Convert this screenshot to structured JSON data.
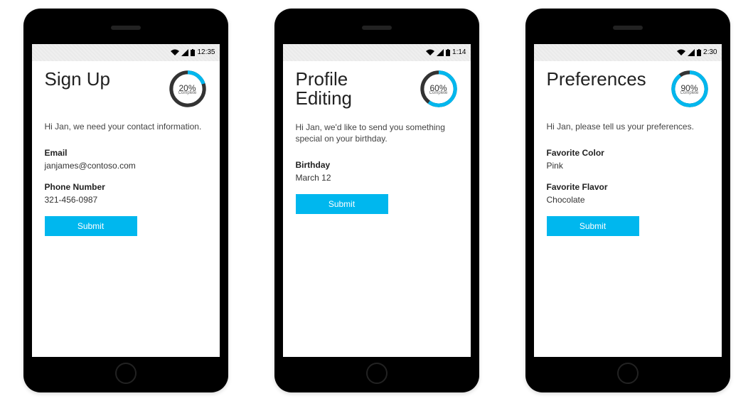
{
  "phones": [
    {
      "time": "12:35",
      "title": "Sign Up",
      "progress_pct": 20,
      "progress_label": "20%",
      "progress_sub": "Complete",
      "intro": "Hi Jan, we need your contact information.",
      "fields": [
        {
          "label": "Email",
          "value": "janjames@contoso.com"
        },
        {
          "label": "Phone Number",
          "value": "321-456-0987"
        }
      ],
      "submit": "Submit"
    },
    {
      "time": "1:14",
      "title": "Profile Editing",
      "progress_pct": 60,
      "progress_label": "60%",
      "progress_sub": "Complete",
      "intro": "Hi Jan, we'd like to send you something special on your birthday.",
      "fields": [
        {
          "label": "Birthday",
          "value": "March 12"
        }
      ],
      "submit": "Submit"
    },
    {
      "time": "2:30",
      "title": "Preferences",
      "progress_pct": 90,
      "progress_label": "90%",
      "progress_sub": "Complete",
      "intro": "Hi Jan, please tell us your preferences.",
      "fields": [
        {
          "label": "Favorite Color",
          "value": "Pink"
        },
        {
          "label": "Favorite Flavor",
          "value": "Chocolate"
        }
      ],
      "submit": "Submit"
    }
  ],
  "colors": {
    "accent": "#00b7ee"
  }
}
